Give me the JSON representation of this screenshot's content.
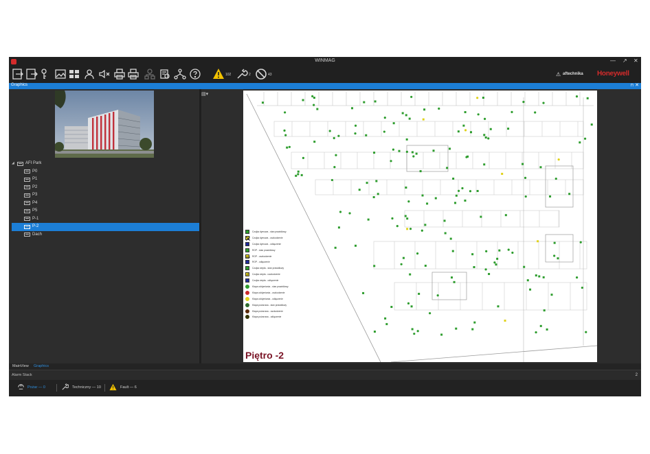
{
  "window": {
    "title": "WINMAG",
    "controls": {
      "minimize": "—",
      "maximize": "↗",
      "close": "✕"
    }
  },
  "toolbar": {
    "buttons": [
      {
        "icon": "login-icon"
      },
      {
        "icon": "logout-icon"
      },
      {
        "icon": "key-icon"
      },
      {
        "icon": "graphics-icon"
      },
      {
        "icon": "grid-icon"
      },
      {
        "icon": "user-icon"
      },
      {
        "icon": "mute-icon"
      },
      {
        "icon": "print-icon"
      },
      {
        "icon": "print-all-icon"
      },
      {
        "icon": "network-disabled-icon"
      },
      {
        "icon": "report-icon"
      },
      {
        "icon": "tree-icon"
      },
      {
        "icon": "help-icon"
      }
    ],
    "warning_count": "102",
    "technical_count": "2",
    "disabled_count": "43",
    "brand_partner": "aftechnika",
    "brand_main": "Honeywell"
  },
  "graphics_tab": {
    "label": "Graphics",
    "pin": "⊓",
    "close": "✕"
  },
  "tree": {
    "root": {
      "label": "AFI Park",
      "expander": "◢"
    },
    "items": [
      {
        "label": "P0"
      },
      {
        "label": "P1"
      },
      {
        "label": "P2"
      },
      {
        "label": "P3"
      },
      {
        "label": "P4"
      },
      {
        "label": "P5"
      },
      {
        "label": "P-1"
      },
      {
        "label": "P-2",
        "selected": true
      },
      {
        "label": "Dach"
      }
    ]
  },
  "floor": {
    "title": "Piętro -2",
    "legend": [
      {
        "text": "Czujka dymowa - stan prawidłowy",
        "shape": "square",
        "color": "#2e9d2e"
      },
      {
        "text": "Czujka dymowa - uszkodzenie",
        "shape": "square-x",
        "color": "#e0d21a"
      },
      {
        "text": "Czujka dymowa - odłączenie",
        "shape": "square",
        "color": "#1f2a9a"
      },
      {
        "text": "ROP - stan prawidłowy",
        "shape": "square",
        "color": "#2e9d2e"
      },
      {
        "text": "ROP - uszkodzenie",
        "shape": "square-line",
        "color": "#e0d21a"
      },
      {
        "text": "ROP - odłączenie",
        "shape": "square",
        "color": "#1f2a9a"
      },
      {
        "text": "Czujka ciepła - stan prawidłowy",
        "shape": "square",
        "color": "#2e9d2e"
      },
      {
        "text": "Czujka ciepła - uszkodzenie",
        "shape": "square-circle",
        "color": "#e0d21a"
      },
      {
        "text": "Czujka ciepła - odłączenie",
        "shape": "square",
        "color": "#1f2a9a"
      },
      {
        "text": "Klapa oddymiania - stan prawidłowy",
        "shape": "circle",
        "color": "#2e9d2e"
      },
      {
        "text": "Klapa oddymiania - uszkodzenie",
        "shape": "circle",
        "color": "#cc2b2b"
      },
      {
        "text": "Klapa oddymiania - odłączenie",
        "shape": "circle",
        "color": "#e0d21a"
      },
      {
        "text": "Klapa pożarowa - stan prawidłowy",
        "shape": "circle",
        "color": "#2e6b2e"
      },
      {
        "text": "Klapa pożarowa - uszkodzenie",
        "shape": "circle",
        "color": "#5a2a0a"
      },
      {
        "text": "Klapa pożarowa - odłączenie",
        "shape": "circle",
        "color": "#333300"
      }
    ]
  },
  "bottom_tabs": [
    {
      "label": "MainView",
      "active": false
    },
    {
      "label": "Graphics",
      "active": true
    }
  ],
  "alarm_stack": {
    "label": "Alarm Stack",
    "count": "2"
  },
  "statusbar": {
    "items": [
      {
        "label": "Pożar — 0",
        "icon": "fire-alarm-icon",
        "color": "#2f8fe0"
      },
      {
        "label": "Techniczny — 10",
        "icon": "wrench-icon",
        "color": "#d0d0d0"
      },
      {
        "label": "Fault — 6",
        "icon": "warning-icon",
        "color": "#d0d0d0"
      }
    ]
  },
  "colors": {
    "accent": "#1c7ed6",
    "ok_device": "#2e9d2e",
    "fault_device": "#e0d21a",
    "brand_red": "#d42b2b",
    "floor_title": "#7a1426"
  }
}
